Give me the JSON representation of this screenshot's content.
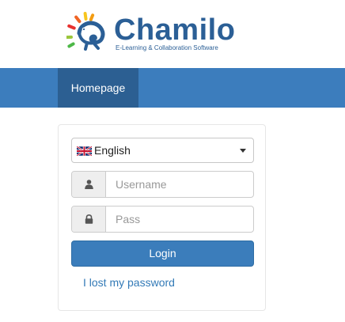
{
  "logo": {
    "wordmark": "Chamilo",
    "tagline": "E-Learning & Collaboration Software",
    "brand_color": "#2b5f96",
    "icon": "chameleon-logo-icon"
  },
  "navbar": {
    "color": "#3c7dbd",
    "items": [
      {
        "label": "Homepage",
        "active": true
      }
    ]
  },
  "login_form": {
    "language_select": {
      "selected": "English",
      "flag_icon": "uk-flag-icon",
      "caret_icon": "caret-down-icon"
    },
    "username": {
      "icon": "user-icon",
      "placeholder": "Username",
      "value": ""
    },
    "password": {
      "icon": "lock-icon",
      "placeholder": "Pass",
      "value": ""
    },
    "submit_label": "Login",
    "lost_password_label": "I lost my password",
    "button_color": "#3b7dbb",
    "link_color": "#337ab7"
  }
}
